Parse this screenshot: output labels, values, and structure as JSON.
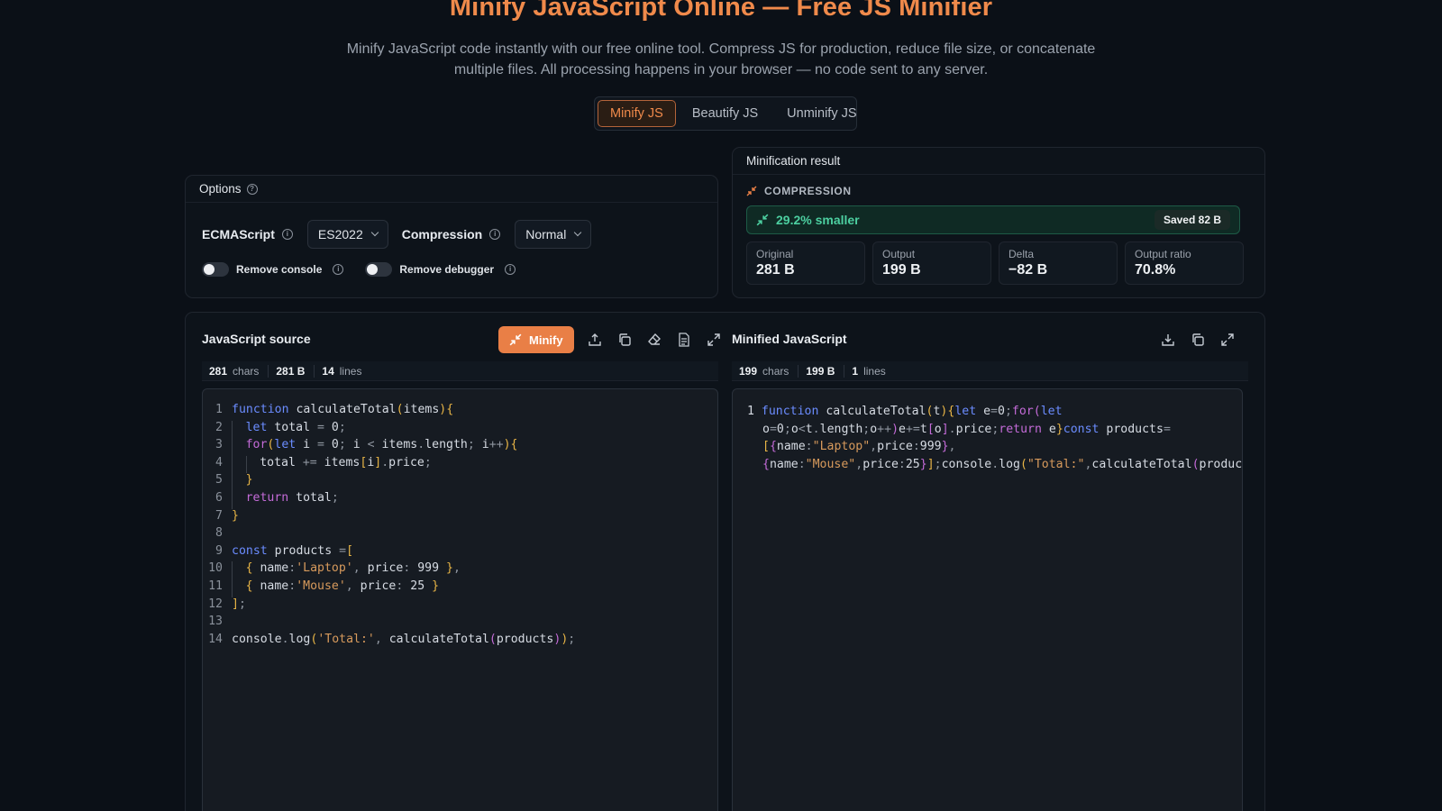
{
  "header": {
    "title": "Minify JavaScript Online — Free JS Minifier",
    "subtitle": "Minify JavaScript code instantly with our free online tool. Compress JS for production, reduce file size, or concatenate multiple files. All processing happens in your browser — no code sent to any server."
  },
  "tabs": [
    {
      "label": "Minify JS",
      "active": true
    },
    {
      "label": "Beautify JS",
      "active": false
    },
    {
      "label": "Unminify JS",
      "active": false
    }
  ],
  "options": {
    "title": "Options",
    "ecmascript_label": "ECMAScript",
    "ecmascript_value": "ES2022",
    "compression_label": "Compression",
    "compression_value": "Normal",
    "remove_console_label": "Remove console",
    "remove_console_on": false,
    "remove_debugger_label": "Remove debugger",
    "remove_debugger_on": false
  },
  "result": {
    "title": "Minification result",
    "section": "COMPRESSION",
    "smaller": "29.2% smaller",
    "saved": "Saved 82 B",
    "stats": [
      {
        "label": "Original",
        "value": "281 B"
      },
      {
        "label": "Output",
        "value": "199 B"
      },
      {
        "label": "Delta",
        "value": "−82 B"
      },
      {
        "label": "Output ratio",
        "value": "70.8%"
      }
    ]
  },
  "source": {
    "title": "JavaScript source",
    "minify_label": "Minify",
    "chars": "281",
    "chars_label": "chars",
    "bytes": "281 B",
    "lines": "14",
    "lines_label": "lines",
    "code_lines": [
      "function calculateTotal(items) {",
      "  let total = 0;",
      "  for (let i = 0; i < items.length; i++) {",
      "    total += items[i].price;",
      "  }",
      "  return total;",
      "}",
      "",
      "const products = [",
      "  { name: 'Laptop', price: 999 },",
      "  { name: 'Mouse', price: 25 }",
      "];",
      "",
      "console.log('Total:', calculateTotal(products));"
    ]
  },
  "output": {
    "title": "Minified JavaScript",
    "chars": "199",
    "chars_label": "chars",
    "bytes": "199 B",
    "lines": "1",
    "lines_label": "lines",
    "code": "function calculateTotal(t){let e=0;for(let o=0;o<t.length;o++)e+=t[o].price;return e}const products=[{name:\"Laptop\",price:999},{name:\"Mouse\",price:25}];console.log(\"Total:\",calculateTotal(products));"
  },
  "colors": {
    "accent": "#f08a4b",
    "success": "#4ccfa0",
    "background": "#0b1017"
  }
}
